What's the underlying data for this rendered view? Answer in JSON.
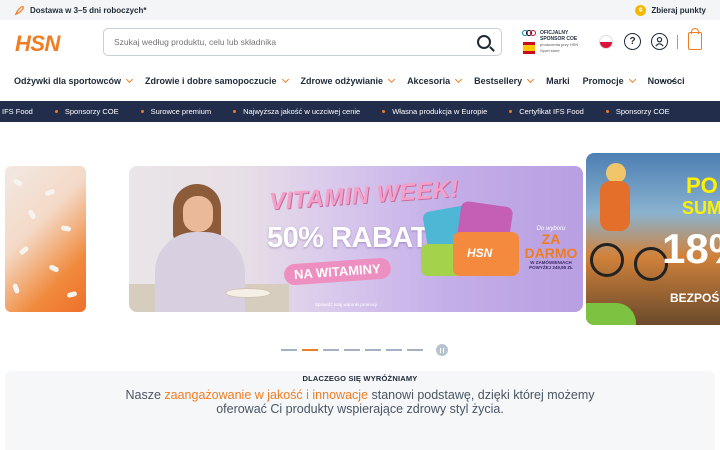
{
  "topbar": {
    "delivery_text": "Dostawa w 3–5 dni roboczych*",
    "points_text": "Zbieraj punkty"
  },
  "header": {
    "logo_text": "HSN",
    "search_placeholder": "Szukaj według produktu, celu lub składnika",
    "coe_title": "OFICJALNY SPONSOR COE",
    "coe_subtitle": "producenta przy HSN Sport store"
  },
  "nav": {
    "items": [
      {
        "label": "Odżywki dla sportowców",
        "has_dropdown": true
      },
      {
        "label": "Zdrowie i dobre samopoczucie",
        "has_dropdown": true
      },
      {
        "label": "Zdrowe odżywianie",
        "has_dropdown": true
      },
      {
        "label": "Akcesoria",
        "has_dropdown": true
      },
      {
        "label": "Bestsellery",
        "has_dropdown": true
      },
      {
        "label": "Marki",
        "has_dropdown": false
      },
      {
        "label": "Promocje",
        "has_dropdown": true
      },
      {
        "label": "Nowości",
        "has_dropdown": false
      }
    ],
    "more_label": "···"
  },
  "ticker": {
    "items": [
      "IFS Food",
      "Sponsorzy COE",
      "Surowce premium",
      "Najwyższa jakość w uczciwej cenie",
      "Własna produkcja w Europie",
      "Certyfikat IFS Food",
      "Sponsorzy COE"
    ]
  },
  "carousel": {
    "main_slide": {
      "headline": "VITAMIN WEEK!",
      "discount": "50% RABATU",
      "tag": "NA WITAMINY",
      "box_label": "HSN",
      "offer_small": "Do wyboru",
      "offer_big": "ZA DARMO",
      "offer_condition": "W ZAMÓWIENIACH POWYŻEJ 249,95 ZŁ",
      "legal": "Sprawdź tutaj warunki promocji."
    },
    "right_slide": {
      "line1": "PO",
      "line2": "SUM",
      "percent": "18%",
      "line3": "BEZPOŚ"
    },
    "dots_count": 7,
    "active_dot": 1
  },
  "why_us": {
    "label": "DLACZEGO SIĘ WYRÓŻNIAMY",
    "text_before": "Nasze ",
    "text_highlight": "zaangażowanie w jakość i innowacje",
    "text_after": " stanowi podstawę, dzięki której możemy oferować Ci produkty wspierające zdrowy styl życia."
  },
  "colors": {
    "brand_orange": "#ef7d23",
    "navy": "#222d4b",
    "text_dark": "#1f2a37"
  }
}
